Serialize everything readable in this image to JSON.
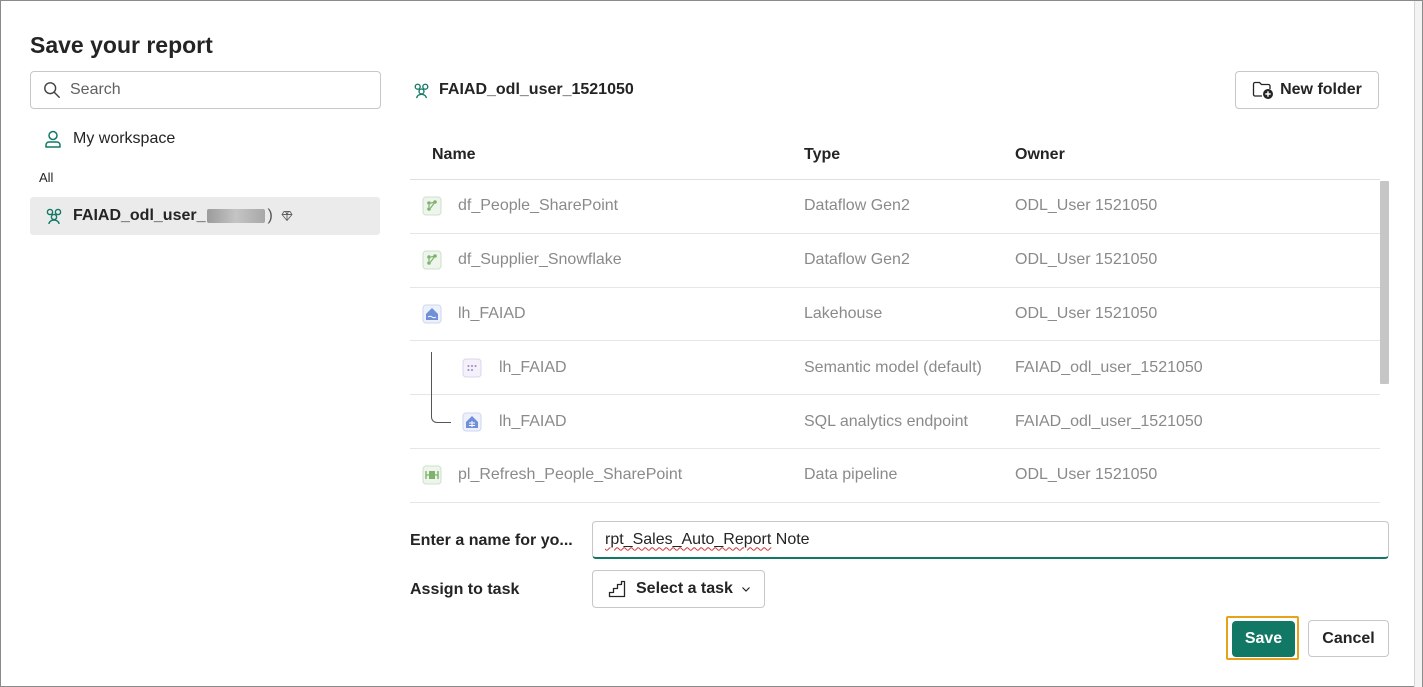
{
  "dialog": {
    "title": "Save your report"
  },
  "left_pane": {
    "search": {
      "placeholder": "Search",
      "value": ""
    },
    "my_workspace": "My workspace",
    "section_label": "All",
    "workspace_item": {
      "label_prefix": "FAIAD_odl_user_",
      "label_suffix": ")"
    }
  },
  "right_pane": {
    "breadcrumb": "FAIAD_odl_user_1521050",
    "new_folder_label": "New folder",
    "table": {
      "headers": {
        "name": "Name",
        "type": "Type",
        "owner": "Owner"
      },
      "rows": [
        {
          "name": "df_People_SharePoint",
          "type": "Dataflow Gen2",
          "owner": "ODL_User 1521050",
          "icon": "dataflow-icon"
        },
        {
          "name": "df_Supplier_Snowflake",
          "type": "Dataflow Gen2",
          "owner": "ODL_User 1521050",
          "icon": "dataflow-icon"
        },
        {
          "name": "lh_FAIAD",
          "type": "Lakehouse",
          "owner": "ODL_User 1521050",
          "icon": "lakehouse-icon"
        },
        {
          "name": "lh_FAIAD",
          "type": "Semantic model (default)",
          "owner": "FAIAD_odl_user_1521050",
          "icon": "semantic-model-icon"
        },
        {
          "name": "lh_FAIAD",
          "type": "SQL analytics endpoint",
          "owner": "FAIAD_odl_user_1521050",
          "icon": "sql-endpoint-icon"
        },
        {
          "name": "pl_Refresh_People_SharePoint",
          "type": "Data pipeline",
          "owner": "ODL_User 1521050",
          "icon": "pipeline-icon"
        }
      ]
    }
  },
  "form": {
    "name_label": "Enter a name for yo...",
    "name_value_part1": "rpt_Sales_Auto_Report",
    "name_value_part2": " Note",
    "task_label": "Assign to task",
    "task_button": "Select a task"
  },
  "actions": {
    "save": "Save",
    "cancel": "Cancel"
  },
  "colors": {
    "accent": "#117865",
    "focus_ring": "#e8a21a",
    "spell_error": "#d13438"
  }
}
